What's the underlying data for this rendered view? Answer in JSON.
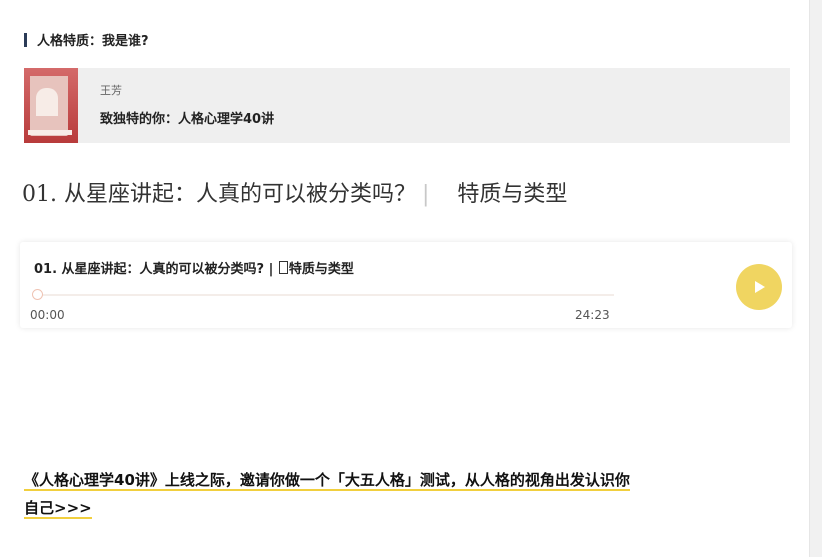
{
  "section": {
    "title": "人格特质：我是谁?"
  },
  "course": {
    "author": "王芳",
    "name": "致独特的你：人格心理学40讲"
  },
  "lesson": {
    "heading_main": "01. 从星座讲起：人真的可以被分类吗？",
    "heading_sep": "|",
    "heading_sub": "特质与类型"
  },
  "audio": {
    "title_prefix": "01. 从星座讲起：人真的可以被分类吗? | ",
    "title_suffix": "特质与类型",
    "current_time": "00:00",
    "duration": "24:23",
    "progress": 0,
    "play_icon": "play-icon",
    "accent_color": "#f0d561"
  },
  "promo": {
    "line1": "《人格心理学40讲》上线之际，邀请你做一个「大五人格」测试，从人格的视角出发认识你",
    "line2": "自己>>>"
  }
}
